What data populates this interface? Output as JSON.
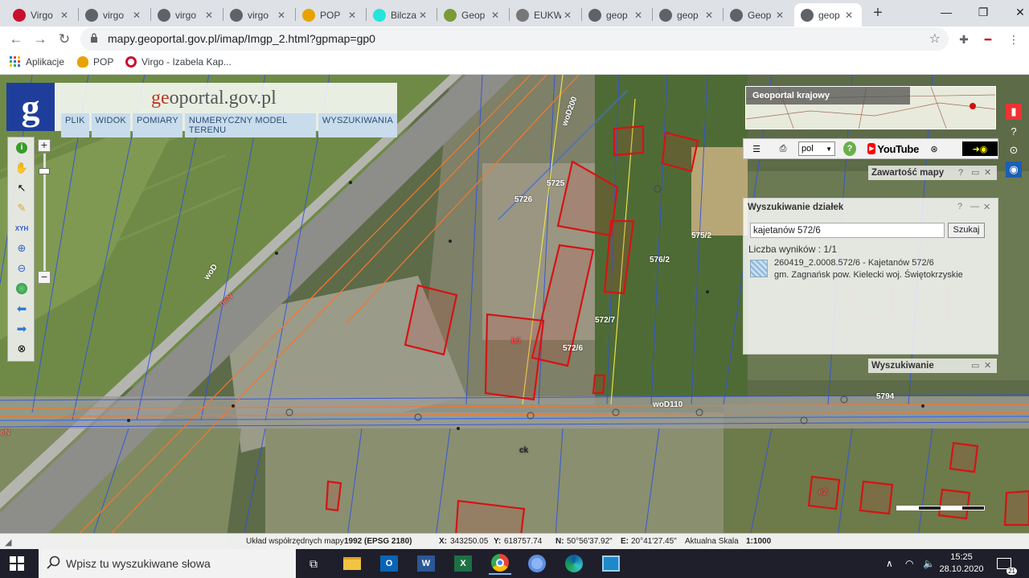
{
  "browser": {
    "tabs": [
      {
        "title": "Virgo",
        "icon": "virgo-icon",
        "color": "#c8102e"
      },
      {
        "title": "virgo",
        "icon": "globe-icon",
        "color": "#5f6368"
      },
      {
        "title": "virgo",
        "icon": "globe-icon",
        "color": "#5f6368"
      },
      {
        "title": "virgo",
        "icon": "globe-icon",
        "color": "#5f6368"
      },
      {
        "title": "POP",
        "icon": "pop-icon",
        "color": "#e8a200"
      },
      {
        "title": "Bilcza",
        "icon": "olx-icon",
        "color": "#23e5db"
      },
      {
        "title": "Geop",
        "icon": "geoportal-icon",
        "color": "#7a9a3a"
      },
      {
        "title": "EUKW",
        "icon": "eukw-icon",
        "color": "#777777"
      },
      {
        "title": "geop",
        "icon": "document-icon",
        "color": "#5f6368"
      },
      {
        "title": "geop",
        "icon": "document-icon",
        "color": "#5f6368"
      },
      {
        "title": "Geop",
        "icon": "document-icon",
        "color": "#5f6368"
      },
      {
        "title": "geop",
        "icon": "document-icon",
        "color": "#5f6368"
      }
    ],
    "active_tab": 11,
    "url": "mapy.geoportal.gov.pl/imap/Imgp_2.html?gpmap=gp0",
    "bookmarks": [
      {
        "label": "Aplikacje",
        "icon": "apps-grid-icon"
      },
      {
        "label": "POP",
        "icon": "pop-icon"
      },
      {
        "label": "Virgo - Izabela Kap...",
        "icon": "virgo-icon"
      }
    ]
  },
  "geoportal": {
    "logo_letter": "g",
    "title_prefix": "ge",
    "title_main": "oportal.gov.pl",
    "menu": [
      "PLIK",
      "WIDOK",
      "POMIARY",
      "NUMERYCZNY MODEL TERENU",
      "WYSZUKIWANIA"
    ],
    "national_label": "Geoportal krajowy",
    "language": "pol",
    "youtube_label": "YouTube",
    "map_content_title": "Zawartość mapy",
    "search_parcels": {
      "title": "Wyszukiwanie działek",
      "query": "kajetanów 572/6",
      "button": "Szukaj",
      "count": "Liczba wyników : 1/1",
      "result_line1": "260419_2.0008.572/6 - Kajetanów 572/6",
      "result_line2": "gm. Zagnańsk pow. Kielecki woj. Świętokrzyskie"
    },
    "search_title": "Wyszukiwanie",
    "status": {
      "crs_label": "Układ współrzędnych mapy",
      "crs_value": "1992 (EPSG 2180)",
      "x_label": "X:",
      "x_value": "343250.05",
      "y_label": "Y:",
      "y_value": "618757.74",
      "n_label": "N:",
      "n_value": "50°56'37.92\"",
      "e_label": "E:",
      "e_value": "20°41'27.45\"",
      "scale_label": "Aktualna Skala",
      "scale_value": "1:1000"
    },
    "map_labels": [
      "woD",
      "woD200",
      "woD110",
      "neN",
      "eN",
      "5725",
      "5726",
      "572/6",
      "572/7",
      "575/2",
      "576/2",
      "5794",
      "ck",
      "e2",
      "b5"
    ]
  },
  "taskbar": {
    "search_placeholder": "Wpisz tu wyszukiwane słowa",
    "time": "15:25",
    "date": "28.10.2020",
    "notifications": "21"
  }
}
